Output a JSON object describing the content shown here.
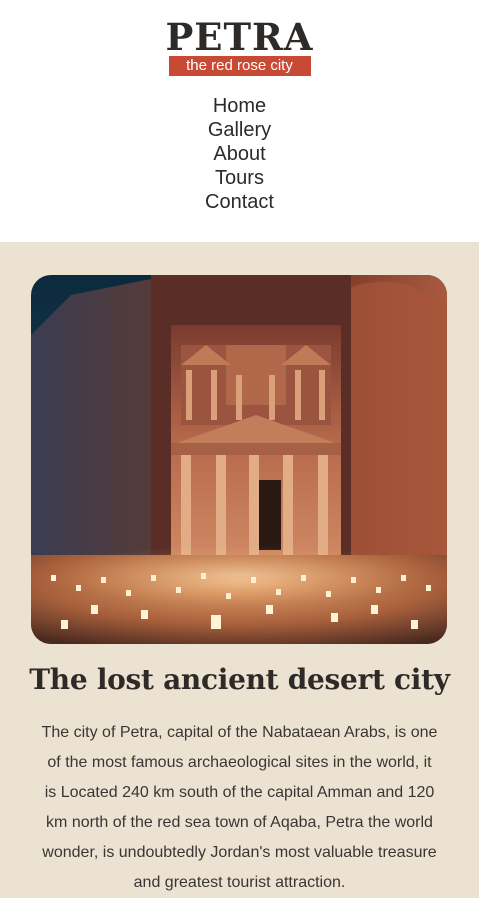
{
  "brand": {
    "title": "PETRA",
    "tagline": "the red rose city"
  },
  "nav": {
    "items": [
      "Home",
      "Gallery",
      "About",
      "Tours",
      "Contact"
    ]
  },
  "hero": {
    "image_alt": "Petra Treasury lit by candles at night"
  },
  "content": {
    "heading": "The lost ancient desert city",
    "paragraph": "The city of Petra, capital of the Nabataean Arabs, is one of the most famous archaeological sites in the world, it is Located 240 km south of the capital Amman and 120 km north of the red sea town of Aqaba, Petra the world wonder, is undoubtedly Jordan's most valuable treasure and greatest tourist attraction."
  },
  "colors": {
    "background": "#ebe2d2",
    "header": "#ffffff",
    "accent": "#c84a35",
    "text": "#2d2a28"
  }
}
